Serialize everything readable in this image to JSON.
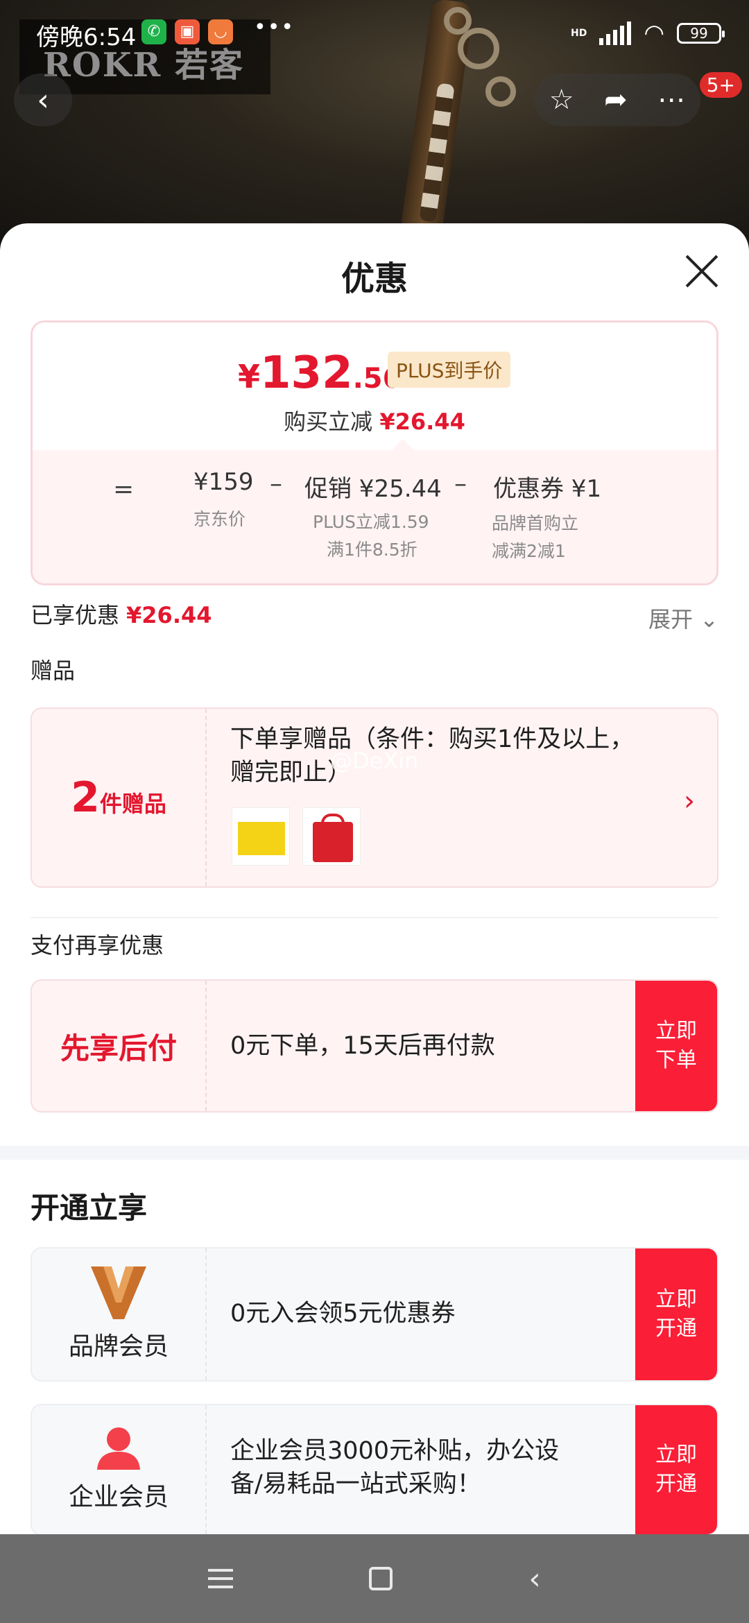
{
  "status_bar": {
    "time": "傍晚6:54",
    "hd": "HD",
    "battery": "99"
  },
  "hero": {
    "brand": "ROKR 若客"
  },
  "nav": {
    "back_icon": "chevron-left-icon",
    "badge": "5+"
  },
  "sheet": {
    "title": "优惠",
    "price": {
      "symbol": "¥",
      "integer": "132",
      "decimal": ".56",
      "plus_tag": "PLUS到手价",
      "buy_label": "购买立减",
      "buy_amount": "¥26.44"
    },
    "calc": {
      "eq": "=",
      "minus": "–",
      "jd_price": "¥159",
      "jd_label": "京东价",
      "promo": "促销 ¥25.44",
      "promo_line1": "PLUS立减1.59",
      "promo_line2": "满1件8.5折",
      "coupon": "优惠券 ¥1",
      "coupon_line1": "品牌首购立",
      "coupon_line2": "减满2减1"
    },
    "enjoyed_label": "已享优惠",
    "enjoyed_amount": "¥26.44",
    "expand": "展开 ⌄",
    "gift_section": "赠品",
    "gift": {
      "count": "2",
      "count_unit": "件赠品",
      "desc_line1": "下单享赠品（条件：购买1件及以上，",
      "desc_line2": "赠完即止）",
      "watermark": "@DeXin"
    },
    "pay_section": "支付再享优惠",
    "pay": {
      "title": "先享后付",
      "desc": "0元下单，15天后再付款",
      "cta_line1": "立即",
      "cta_line2": "下单"
    },
    "open_head": "开通立享",
    "members": [
      {
        "name": "品牌会员",
        "desc_line1": "0元入会领5元优惠券",
        "desc_line2": "",
        "cta_line1": "立即",
        "cta_line2": "开通"
      },
      {
        "name": "企业会员",
        "desc_line1": " 企业会员3000元补贴，办公设",
        "desc_line2": "备/易耗品一站式采购！",
        "cta_line1": "立即",
        "cta_line2": "开通"
      }
    ]
  },
  "colors": {
    "accent": "#e3172e",
    "cta": "#fa1e36"
  }
}
